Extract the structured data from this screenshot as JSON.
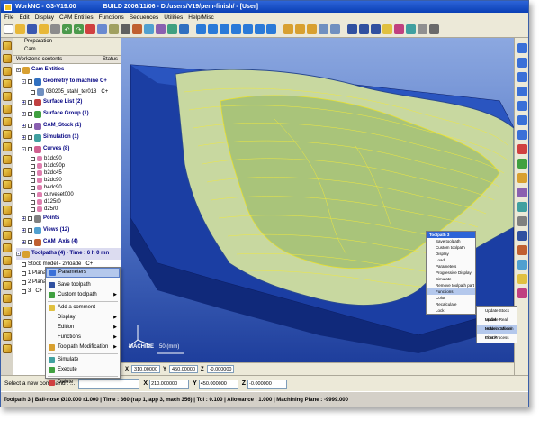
{
  "window": {
    "title": "WorkNC - G3-V19.00",
    "build": "BUILD 2006/11/06 - D:/users/V19/pem-finish/ - [User]"
  },
  "menu": [
    "File",
    "Edit",
    "Display",
    "CAM Entities",
    "Functions",
    "Sequences",
    "Utilities",
    "Help/Misc"
  ],
  "panel": {
    "tabs": [
      "Preparation",
      "Cam"
    ],
    "header_left": "Workzone contents",
    "header_right": "Status",
    "tree": {
      "cam_entities": "Cam Entities",
      "geometry": "Geometry to machine C+",
      "geometry_file": "030205_stahl_ter018",
      "geometry_file_status": "C+",
      "surface_list": "Surface List (2)",
      "surface_group": "Surface Group (1)",
      "cam_stock": "CAM_Stock (1)",
      "simulation": "Simulation (1)",
      "curves": "Curves (8)",
      "curve_items": [
        "b1dc90",
        "b1dc90p",
        "b2dc45",
        "b2dc90",
        "b4dc90",
        "curveset000",
        "d125r0",
        "d25r0"
      ],
      "points": "Points",
      "views": "Views (12)",
      "cam_axis": "CAM_Axis (4)",
      "toolpaths": "Toolpaths (4) - Time : 6 h 0 mn",
      "stock_model": "Stock model - 2vloade",
      "stock_model_status": "C+",
      "toolpath_items": [
        {
          "label": "1 Planar finishing",
          "status": "C+"
        },
        {
          "label": "2 Planar finishing",
          "status": "C+"
        },
        {
          "label": "3",
          "status": "C+"
        }
      ]
    }
  },
  "context_menu": {
    "items": [
      {
        "label": "Parameters",
        "submenu": false
      },
      {
        "label": "Save toolpath",
        "submenu": false
      },
      {
        "label": "Custom toolpath",
        "submenu": true
      },
      {
        "label": "Add a comment",
        "submenu": false
      },
      {
        "label": "Display",
        "submenu": true
      },
      {
        "label": "Edition",
        "submenu": true
      },
      {
        "label": "Functions",
        "submenu": true
      },
      {
        "label": "Toolpath Modification",
        "submenu": true
      },
      {
        "label": "Simulate",
        "submenu": false
      },
      {
        "label": "Execute",
        "submenu": false
      },
      {
        "label": "Delete",
        "submenu": false
      }
    ]
  },
  "floating_menu": {
    "title": "Toolpath 3",
    "items": [
      "Save toolpath",
      "Custom toolpath",
      "Display",
      "Load",
      "Parameters",
      "Progressive Display",
      "Simulate",
      "Remove toolpath part",
      "Functions",
      "Color",
      "Recalculate",
      "Lock"
    ],
    "submenu": [
      "Update Stock Model",
      "Update Real Material Model",
      "Holder Collision Check",
      "Post Process"
    ]
  },
  "viewport": {
    "machine_label": "MACHINE",
    "scale_label": "50 (mm)",
    "coords": {
      "x_label": "X",
      "x_value": "310.00000",
      "y_label": "Y",
      "y_value": "450.00000",
      "z_label": "Z",
      "z_value": "-0.000000"
    }
  },
  "command": {
    "prompt": "Select a new command : ...",
    "x_label": "X",
    "x_value": "210.000000",
    "y_label": "Y",
    "y_value": "450.000000",
    "z_label": "Z",
    "z_value": "-0.000000"
  },
  "status": {
    "text": "Toolpath 3 | Ball-nose Ø10.000 r1.000 | Time : 360 (rap 1, app 3, mach 356) | Tol : 0.100 | Allowance : 1.000 | Machining Plane : -9999.000"
  },
  "colors": {
    "title_blue": "#0a3fb5",
    "part_blue": "#1a3fa0",
    "toolpath_yellow": "#f0e840"
  }
}
